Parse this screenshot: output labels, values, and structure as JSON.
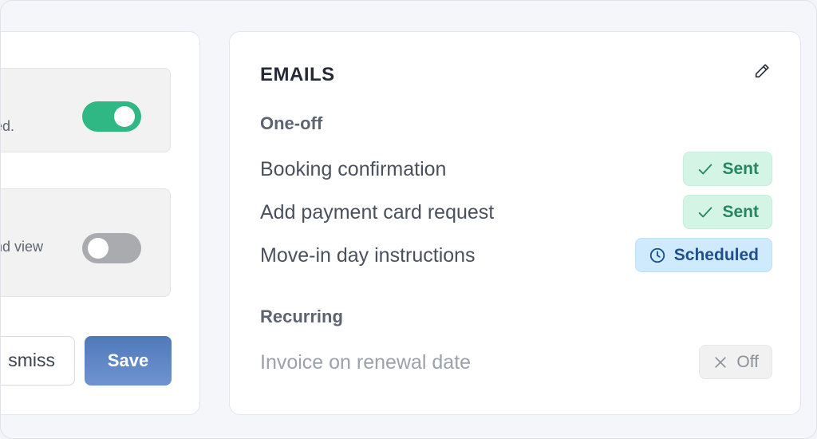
{
  "left_panel": {
    "setting_one": {
      "text": "ed.",
      "toggle_state": "on"
    },
    "setting_two": {
      "text": "nd view",
      "toggle_state": "off"
    },
    "dismiss_label": "smiss",
    "save_label": "Save"
  },
  "emails": {
    "title": "EMAILS",
    "one_off_label": "One-off",
    "recurring_label": "Recurring",
    "items": [
      {
        "name": "Booking confirmation",
        "status": "Sent",
        "status_icon": "check-icon"
      },
      {
        "name": "Add payment card request",
        "status": "Sent",
        "status_icon": "check-icon"
      },
      {
        "name": "Move-in day instructions",
        "status": "Scheduled",
        "status_icon": "clock-icon"
      },
      {
        "name": "Invoice on renewal date",
        "status": "Off",
        "status_icon": "x-icon"
      }
    ]
  },
  "colors": {
    "toggle_on": "#2fb883",
    "toggle_off": "#a9abaf",
    "save_button": "#5a82c2",
    "sent_badge": "#d4f4e6",
    "scheduled_badge": "#cfeafc",
    "off_badge": "#f1f1f2"
  }
}
